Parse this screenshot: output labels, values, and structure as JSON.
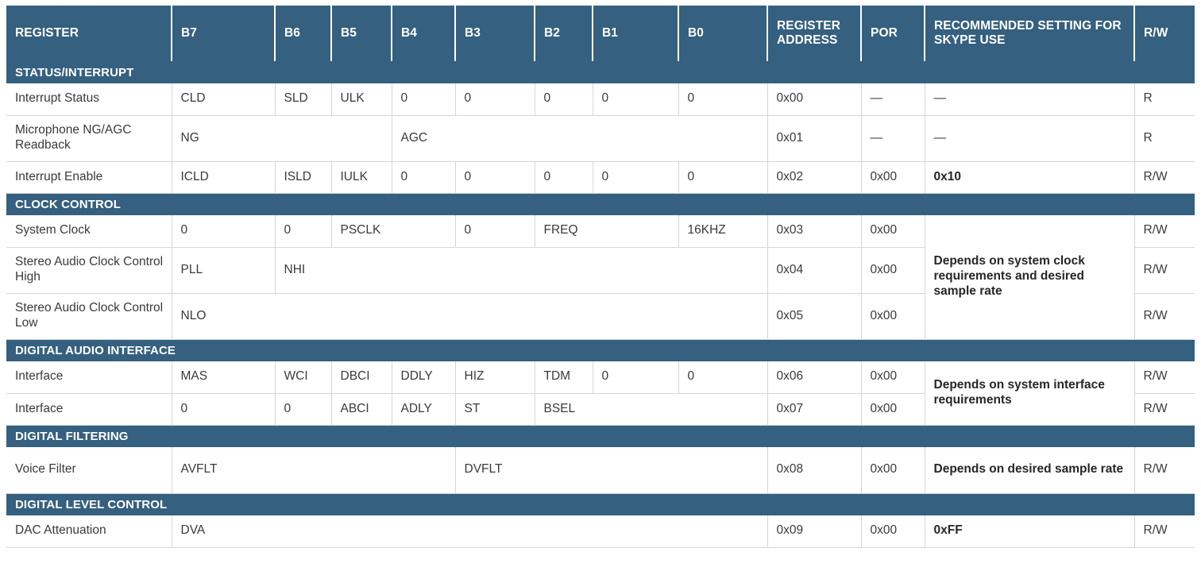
{
  "top_sliver_text": ". .. . .. .. .  . .    .. .   .  .",
  "colors": {
    "header_blue": "#35607f",
    "section_blue": "#35607f",
    "grid_line": "#d2d7db",
    "body_text": "#3a3a3a",
    "header_text": "#ffffff"
  },
  "table": {
    "columns": [
      {
        "key": "register",
        "label": "REGISTER"
      },
      {
        "key": "b7",
        "label": "B7"
      },
      {
        "key": "b6",
        "label": "B6"
      },
      {
        "key": "b5",
        "label": "B5"
      },
      {
        "key": "b4",
        "label": "B4"
      },
      {
        "key": "b3",
        "label": "B3"
      },
      {
        "key": "b2",
        "label": "B2"
      },
      {
        "key": "b1",
        "label": "B1"
      },
      {
        "key": "b0",
        "label": "B0"
      },
      {
        "key": "address",
        "label": "REGISTER ADDRESS"
      },
      {
        "key": "por",
        "label": "POR"
      },
      {
        "key": "recommended",
        "label": "RECOMMENDED SETTING FOR SKYPE USE"
      },
      {
        "key": "rw",
        "label": "R/W"
      }
    ],
    "sections": [
      {
        "title": "STATUS/INTERRUPT",
        "rows": [
          {
            "register": "Interrupt Status",
            "bits": [
              "CLD",
              "SLD",
              "ULK",
              "0",
              "0",
              "0",
              "0",
              "0"
            ],
            "address": "0x00",
            "por": "—",
            "recommended": "—",
            "rw": "R"
          },
          {
            "register": "Microphone NG/AGC Readback",
            "bits": [
              "NG",
              "AGC"
            ],
            "address": "0x01",
            "por": "—",
            "recommended": "—",
            "rw": "R"
          },
          {
            "register": "Interrupt Enable",
            "bits": [
              "ICLD",
              "ISLD",
              "IULK",
              "0",
              "0",
              "0",
              "0",
              "0"
            ],
            "address": "0x02",
            "por": "0x00",
            "recommended": "0x10",
            "rw": "R/W"
          }
        ]
      },
      {
        "title": "CLOCK CONTROL",
        "rows": [
          {
            "register": "System Clock",
            "bits": [
              "0",
              "0",
              "PSCLK",
              "0",
              "FREQ",
              "16KHZ"
            ],
            "address": "0x03",
            "por": "0x00",
            "recommended": "Depends on system clock requirements and desired sample rate",
            "rw": "R/W"
          },
          {
            "register": "Stereo Audio Clock Control High",
            "bits": [
              "PLL",
              "NHI"
            ],
            "address": "0x04",
            "por": "0x00",
            "recommended": "",
            "rw": "R/W"
          },
          {
            "register": "Stereo Audio Clock Control Low",
            "bits": [
              "NLO"
            ],
            "address": "0x05",
            "por": "0x00",
            "recommended": "",
            "rw": "R/W"
          }
        ]
      },
      {
        "title": "DIGITAL AUDIO INTERFACE",
        "rows": [
          {
            "register": "Interface",
            "bits": [
              "MAS",
              "WCI",
              "DBCI",
              "DDLY",
              "HIZ",
              "TDM",
              "0",
              "0"
            ],
            "address": "0x06",
            "por": "0x00",
            "recommended": "Depends on system interface requirements",
            "rw": "R/W"
          },
          {
            "register": "Interface",
            "bits": [
              "0",
              "0",
              "ABCI",
              "ADLY",
              "ST",
              "BSEL"
            ],
            "address": "0x07",
            "por": "0x00",
            "recommended": "",
            "rw": "R/W"
          }
        ]
      },
      {
        "title": "DIGITAL FILTERING",
        "rows": [
          {
            "register": "Voice Filter",
            "bits": [
              "AVFLT",
              "DVFLT"
            ],
            "address": "0x08",
            "por": "0x00",
            "recommended": "Depends on desired sample rate",
            "rw": "R/W"
          }
        ]
      },
      {
        "title": "DIGITAL LEVEL CONTROL",
        "rows": [
          {
            "register": "DAC Attenuation",
            "bits": [
              "DVA"
            ],
            "address": "0x09",
            "por": "0x00",
            "recommended": "0xFF",
            "rw": "R/W"
          }
        ]
      }
    ]
  }
}
